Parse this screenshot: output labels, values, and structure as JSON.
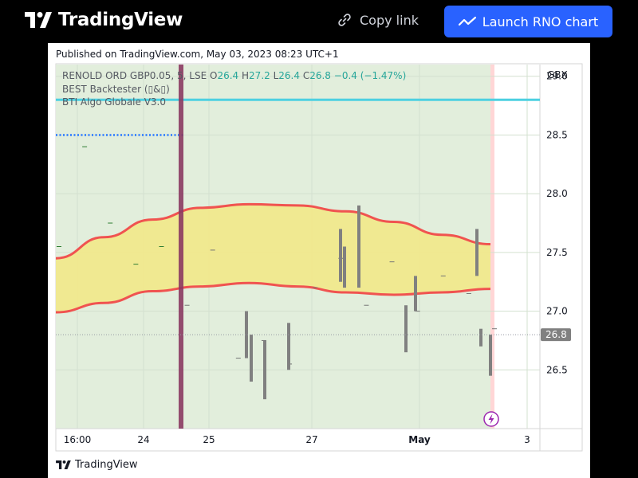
{
  "header": {
    "brand": "TradingView",
    "copy_link_label": "Copy link",
    "launch_label": "Launch RNO chart"
  },
  "published": "Published on TradingView.com, May 03, 2023 08:23 UTC+1",
  "legend": {
    "symbol": "RENOLD ORD GBP0.05, 5, LSE",
    "o_label": "O",
    "o_value": "26.4",
    "h_label": "H",
    "h_value": "27.2",
    "l_label": "L",
    "l_value": "26.4",
    "c_label": "C",
    "c_value": "26.8",
    "change": "−0.4 (−1.47%)",
    "indicator1": "BEST Backtester (▯&▯)",
    "indicator2": "BTI Algo Globale V3.0"
  },
  "footer_brand": "TradingView",
  "colors": {
    "accent": "#2962ff",
    "band_fill": "#f0e88c",
    "band_line": "#f05350",
    "session_bg": "#e2eedc",
    "cyan_line": "#4dd0e1",
    "blue_dots": "#448aff",
    "vertical_bar": "#8b3a62",
    "candle": "#808080"
  },
  "chart_data": {
    "type": "candlestick",
    "currency": "GBX",
    "ylim": [
      26.0,
      29.1
    ],
    "y_ticks": [
      "29.0",
      "28.5",
      "28.0",
      "27.5",
      "27.0",
      "26.5"
    ],
    "x_ticks": [
      "16:00",
      "24",
      "25",
      "27",
      "May",
      "3"
    ],
    "last_price_label": "26.8",
    "cyan_level": 28.8,
    "dotted_level": 28.5,
    "band_upper": [
      27.45,
      27.63,
      27.78,
      27.88,
      27.91,
      27.9,
      27.85,
      27.76,
      27.65,
      27.57
    ],
    "band_lower": [
      26.99,
      27.07,
      27.17,
      27.21,
      27.24,
      27.21,
      27.16,
      27.14,
      27.16,
      27.19
    ],
    "candles": [
      {
        "o": 26.9,
        "h": 27.0,
        "l": 26.6,
        "c": 26.9
      },
      {
        "o": 26.8,
        "h": 26.8,
        "l": 26.4,
        "c": 26.8
      },
      {
        "o": 26.6,
        "h": 26.75,
        "l": 26.25,
        "c": 26.6
      },
      {
        "o": 26.9,
        "h": 26.9,
        "l": 26.5,
        "c": 26.9
      },
      {
        "o": 27.7,
        "h": 27.7,
        "l": 27.25,
        "c": 27.7
      },
      {
        "o": 27.5,
        "h": 27.55,
        "l": 27.2,
        "c": 27.5
      },
      {
        "o": 27.9,
        "h": 27.9,
        "l": 27.2,
        "c": 27.9
      },
      {
        "o": 27.0,
        "h": 27.05,
        "l": 26.65,
        "c": 27.0
      },
      {
        "o": 27.3,
        "h": 27.3,
        "l": 27.0,
        "c": 27.3
      },
      {
        "o": 27.7,
        "h": 27.7,
        "l": 27.3,
        "c": 27.7
      },
      {
        "o": 26.85,
        "h": 26.85,
        "l": 26.7,
        "c": 26.85
      },
      {
        "o": 26.8,
        "h": 26.8,
        "l": 26.45,
        "c": 26.8
      }
    ],
    "doji_marks": [
      {
        "t": 0,
        "v": 27.55
      },
      {
        "t": 1,
        "v": 28.4
      },
      {
        "t": 2,
        "v": 27.75
      },
      {
        "t": 3,
        "v": 27.4
      },
      {
        "t": 4,
        "v": 27.55
      },
      {
        "t": 5,
        "v": 27.05
      },
      {
        "t": 6,
        "v": 27.52
      },
      {
        "t": 7,
        "v": 26.6
      },
      {
        "t": 8,
        "v": 26.75
      },
      {
        "t": 9,
        "v": 26.55
      },
      {
        "t": 10,
        "v": 27.2
      },
      {
        "t": 11,
        "v": 27.45
      },
      {
        "t": 12,
        "v": 27.05
      },
      {
        "t": 13,
        "v": 27.42
      },
      {
        "t": 14,
        "v": 27.0
      },
      {
        "t": 15,
        "v": 27.3
      },
      {
        "t": 16,
        "v": 27.15
      },
      {
        "t": 17,
        "v": 26.85
      }
    ]
  }
}
